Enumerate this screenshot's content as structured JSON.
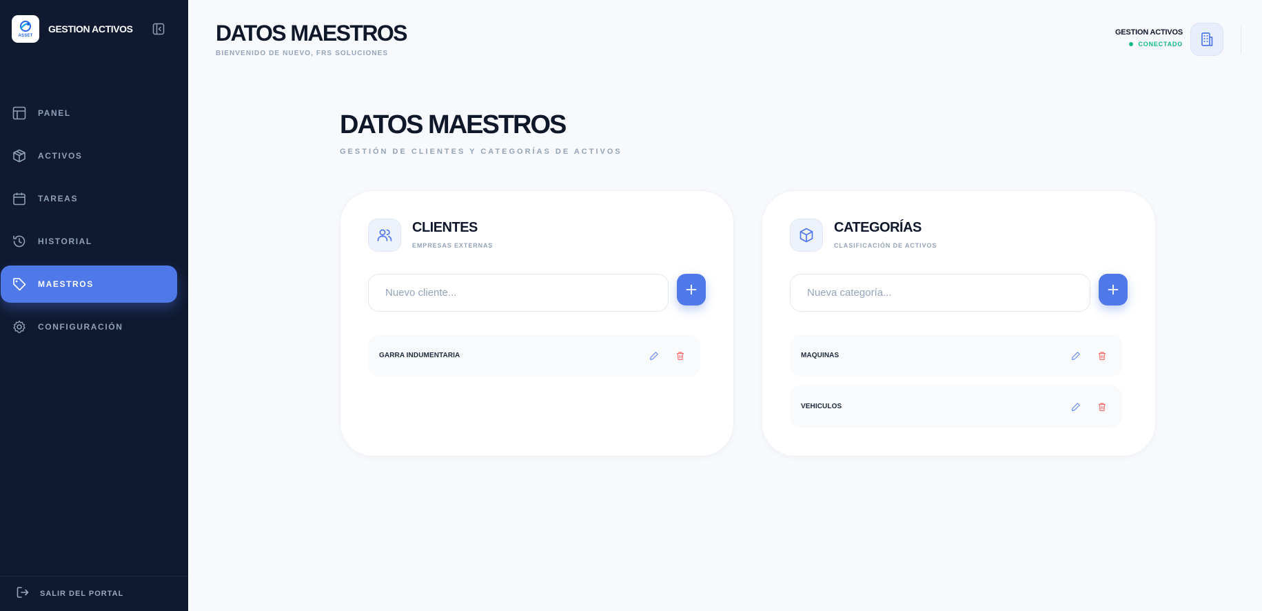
{
  "brand": {
    "name": "GESTION ACTIVOS",
    "logo_text": "ASSET"
  },
  "sidebar": {
    "items": [
      {
        "label": "PANEL",
        "icon": "layout-icon",
        "active": false
      },
      {
        "label": "ACTIVOS",
        "icon": "box-icon",
        "active": false
      },
      {
        "label": "TAREAS",
        "icon": "calendar-icon",
        "active": false
      },
      {
        "label": "HISTORIAL",
        "icon": "history-icon",
        "active": false
      },
      {
        "label": "MAESTROS",
        "icon": "tag-icon",
        "active": true
      },
      {
        "label": "CONFIGURACIÓN",
        "icon": "gear-icon",
        "active": false
      }
    ],
    "footer": {
      "label": "SALIR DEL PORTAL",
      "icon": "logout-icon"
    }
  },
  "header": {
    "title": "DATOS MAESTROS",
    "subtitle": "BIENVENIDO DE NUEVO, FRS SOLUCIONES",
    "user": {
      "name": "GESTION ACTIVOS",
      "status": "CONECTADO",
      "icon": "building-icon"
    }
  },
  "page": {
    "title": "DATOS MAESTROS",
    "subtitle": "GESTIÓN DE CLIENTES Y CATEGORÍAS DE ACTIVOS"
  },
  "clients": {
    "title": "CLIENTES",
    "subtitle": "EMPRESAS EXTERNAS",
    "icon": "users-icon",
    "input_placeholder": "Nuevo cliente...",
    "items": [
      "GARRA INDUMENTARIA"
    ]
  },
  "categories": {
    "title": "CATEGORÍAS",
    "subtitle": "CLASIFICACIÓN DE ACTIVOS",
    "icon": "box-icon",
    "input_placeholder": "Nueva categoría...",
    "items": [
      "MAQUINAS",
      "VEHICULOS"
    ]
  },
  "colors": {
    "sidebar_bg": "#0f1a30",
    "accent": "#4f78e8",
    "status_green": "#10b981",
    "delete_red": "#f87171",
    "edit_blue": "#6b8fe8"
  }
}
